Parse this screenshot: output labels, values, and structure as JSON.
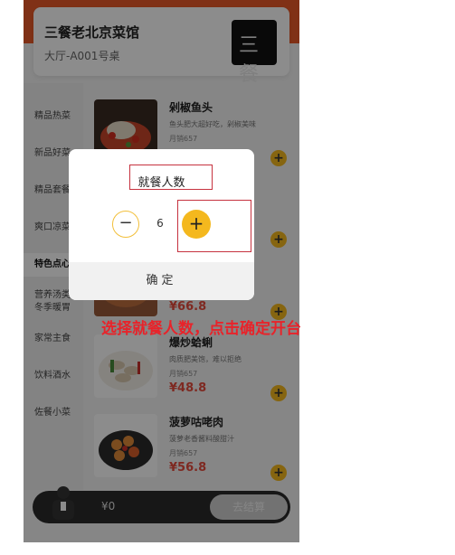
{
  "shop": {
    "name": "三餐老北京菜馆",
    "table": "大厅-A001号桌",
    "logo_text": "三餐"
  },
  "categories": [
    {
      "label": "精品热菜"
    },
    {
      "label": "新品好菜"
    },
    {
      "label": "精品套餐"
    },
    {
      "label": "爽口凉菜"
    },
    {
      "label": "特色点心"
    },
    {
      "label": "营养汤类"
    },
    {
      "label": "冬季暖胃"
    },
    {
      "label": "家常主食"
    },
    {
      "label": "饮料酒水"
    },
    {
      "label": "佐餐小菜"
    }
  ],
  "foods": [
    {
      "name": "剁椒鱼头",
      "desc": "鱼头肥大超好吃，剁椒美味",
      "sold": "月销657",
      "price": ""
    },
    {
      "name": "",
      "desc": "",
      "sold": "",
      "price": "¥66.8"
    },
    {
      "name": "爆炒蛤蜊",
      "desc": "肉质肥美饱，难以拒绝",
      "sold": "月销657",
      "price": "¥48.8"
    },
    {
      "name": "菠萝咕咾肉",
      "desc": "菠萝老香酱料酸甜汁",
      "sold": "月销657",
      "price": "¥56.8"
    }
  ],
  "cart": {
    "price": "¥0",
    "checkout_label": "去结算"
  },
  "dialog": {
    "title": "就餐人数",
    "count": "6",
    "minus_symbol": "−",
    "plus_symbol": "+",
    "confirm_label": "确定"
  },
  "instruction": "选择就餐人数，点击确定开台",
  "colors": {
    "brand": "#ea5a28",
    "accent": "#f4b81e",
    "price": "#e64b3c",
    "annotation": "#e8232a"
  }
}
